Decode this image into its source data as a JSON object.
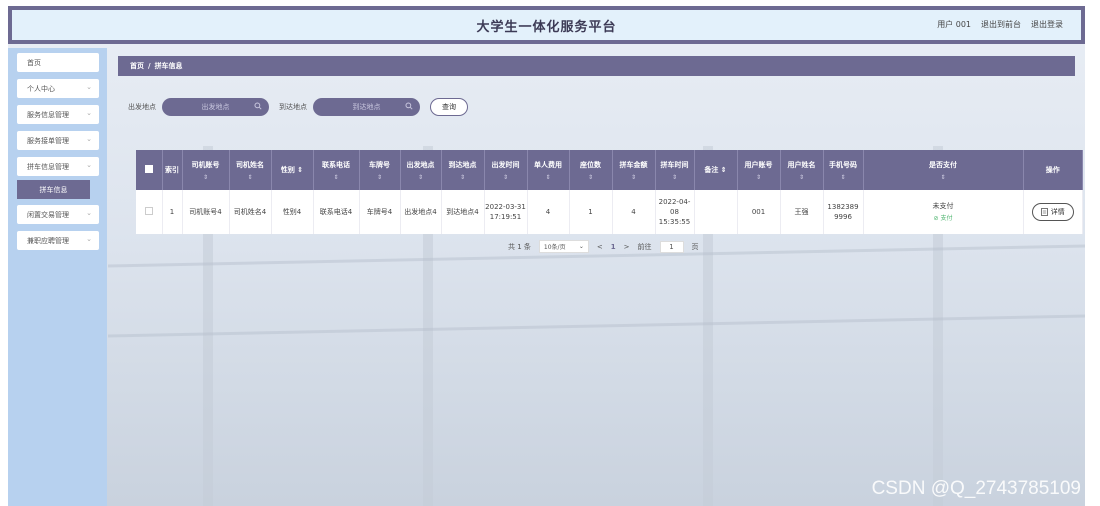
{
  "header": {
    "title": "大学生一体化服务平台",
    "user_label": "用户 001",
    "exit_front": "退出到前台",
    "logout": "退出登录"
  },
  "sidebar": {
    "items": [
      {
        "label": "首页",
        "has_chevron": false
      },
      {
        "label": "个人中心",
        "has_chevron": true
      },
      {
        "label": "服务信息管理",
        "has_chevron": true
      },
      {
        "label": "服务接单管理",
        "has_chevron": true
      },
      {
        "label": "拼车信息管理",
        "has_chevron": true
      },
      {
        "label": "拼车信息",
        "submenu": true
      },
      {
        "label": "闲置交易管理",
        "has_chevron": true
      },
      {
        "label": "兼职应聘管理",
        "has_chevron": true
      }
    ]
  },
  "breadcrumb": {
    "home": "首页",
    "sep": "/",
    "current": "拼车信息"
  },
  "search": {
    "depart_label": "出发地点",
    "depart_placeholder": "出发地点",
    "arrive_label": "到达地点",
    "arrive_placeholder": "到达地点",
    "query_button": "查询"
  },
  "table": {
    "sort_glyph": "⇕",
    "columns": [
      "索引",
      "司机账号",
      "司机姓名",
      "性别",
      "联系电话",
      "车牌号",
      "出发地点",
      "到达地点",
      "出发时间",
      "单人费用",
      "座位数",
      "拼车金额",
      "拼车时间",
      "备注",
      "用户账号",
      "用户姓名",
      "手机号码",
      "是否支付",
      "操作"
    ],
    "rows": [
      {
        "index": "1",
        "driver_account": "司机账号4",
        "driver_name": "司机姓名4",
        "gender": "性别4",
        "phone": "联系电话4",
        "plate": "车牌号4",
        "depart": "出发地点4",
        "arrive": "到达地点4",
        "depart_time": "2022-03-31 17:19:51",
        "fee": "4",
        "seats": "1",
        "amount": "4",
        "carpool_time": "2022-04-08 15:35:55",
        "remark": "",
        "user_account": "001",
        "user_name": "王强",
        "mobile": "13823899996",
        "paid_status": "未支付",
        "pay_link": "支付",
        "detail_button": "详情"
      }
    ]
  },
  "pagination": {
    "total": "共 1 条",
    "page_size": "10条/页",
    "prev": "<",
    "current": "1",
    "next": ">",
    "goto_label": "前往",
    "goto_value": "1",
    "page_suffix": "页"
  },
  "watermark": "CSDN @Q_2743785109",
  "colors": {
    "accent": "#6d6a92",
    "sidebar": "#b7d1ef",
    "header_bg": "#e3f1fb",
    "paid_link": "#49b36b"
  }
}
